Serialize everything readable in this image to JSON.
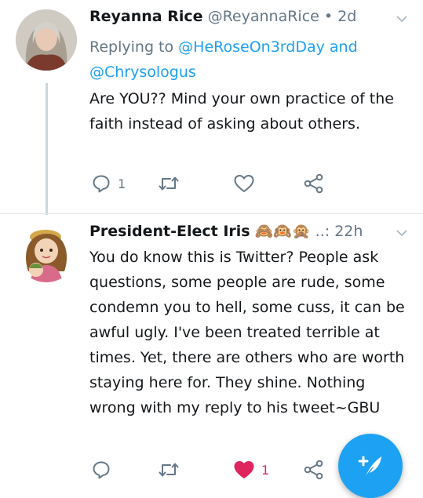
{
  "tweets": [
    {
      "author_name": "Reyanna Rice",
      "author_handle": "@ReyannaRice",
      "separator": "•",
      "time": "2d",
      "replying_prefix": "Replying to",
      "replying_to": [
        "@HeRoseOn3rdDay",
        "@Chrysologus"
      ],
      "replying_joiner": "and",
      "text": "Are YOU?? Mind your own practice of the faith instead of asking about others.",
      "reply_count": "1",
      "retweet_count": "",
      "like_count": "",
      "liked": false
    },
    {
      "author_name": "President-Elect Iris",
      "name_emoji": "🙈🙉🙊",
      "truncation": "..:",
      "time": "22h",
      "text": "You do know this is Twitter? People ask questions, some people are rude, some condemn you to hell, some cuss, it can be awful ugly. I've been treated terrible at times. Yet,  there are others who are worth staying here for. They shine. Nothing wrong with my reply to his tweet~GBU",
      "reply_count": "",
      "retweet_count": "",
      "like_count": "1",
      "liked": true
    }
  ],
  "icons": {
    "reply": "reply-icon",
    "retweet": "retweet-icon",
    "like": "heart-icon",
    "share": "share-icon",
    "caret": "chevron-down-icon",
    "compose": "compose-tweet-icon"
  },
  "colors": {
    "accent": "#1da1f2",
    "like": "#e0245e",
    "secondary_text": "#657786",
    "divider": "#e1e8ed"
  }
}
